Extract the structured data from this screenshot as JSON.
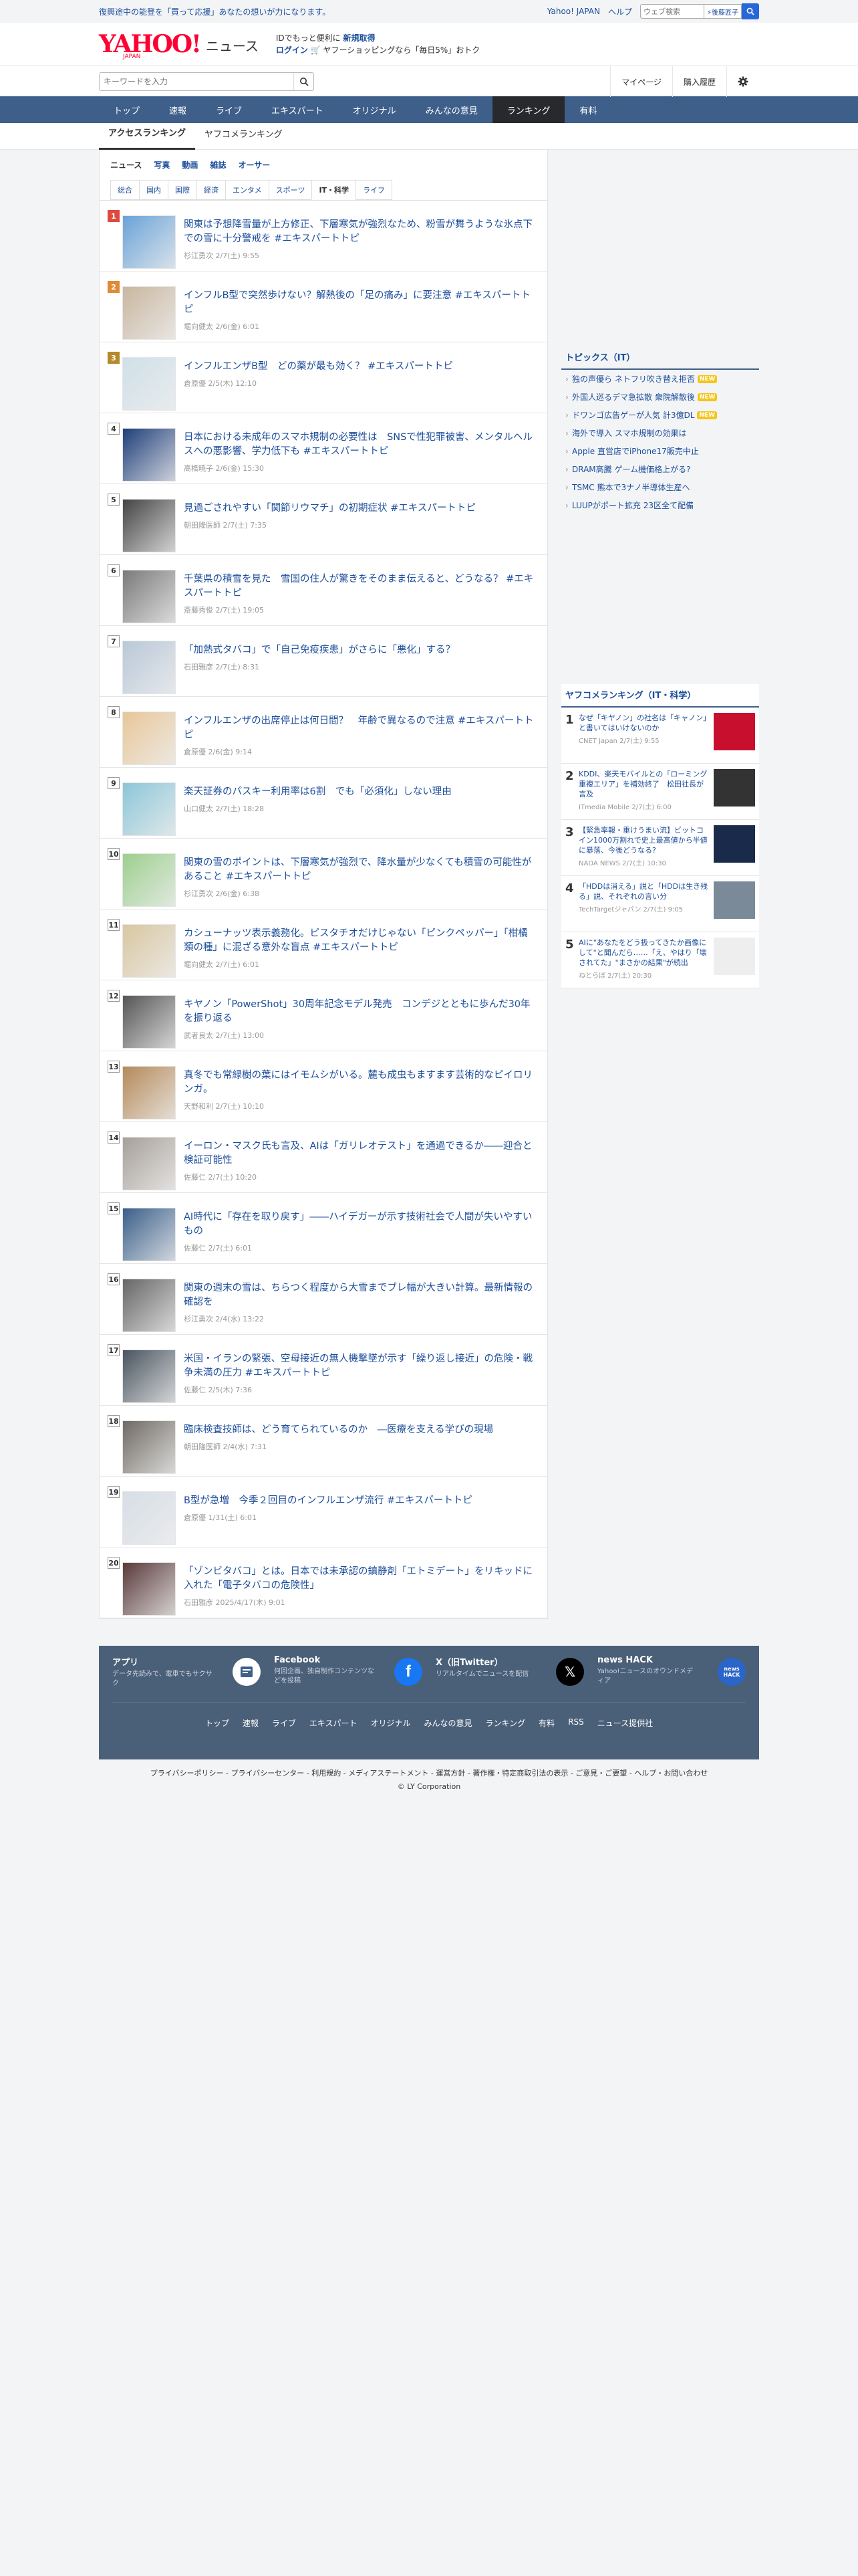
{
  "top": {
    "message": "復興途中の能登を「買って応援」あなたの想いが力になります。",
    "links": [
      "Yahoo! JAPAN",
      "ヘルプ"
    ],
    "search_placeholder": "ウェブ検索",
    "search_chip": "⚡後藤匠子"
  },
  "header": {
    "logo": "YAHOO!",
    "logo_sub": "JAPAN",
    "logo_news": "ニュース",
    "promo_line1a": "IDでもっと便利に",
    "promo_line1b": "新規取得",
    "promo_line2a": "ログイン",
    "promo_line2b": "ヤフーショッピングなら「毎日5%」おトク"
  },
  "searchbar": {
    "placeholder": "キーワードを入力",
    "mypage": "マイページ",
    "history": "購入履歴"
  },
  "gnav": [
    "トップ",
    "速報",
    "ライブ",
    "エキスパート",
    "オリジナル",
    "みんなの意見",
    "ランキング",
    "有料"
  ],
  "gnav_active": "ランキング",
  "subtabs": [
    "アクセスランキング",
    "ヤフコメランキング"
  ],
  "catnav": [
    "ニュース",
    "写真",
    "動画",
    "雑誌",
    "オーサー"
  ],
  "genre_tabs": [
    "総合",
    "国内",
    "国際",
    "経済",
    "エンタメ",
    "スポーツ",
    "IT・科学",
    "ライフ"
  ],
  "genre_active": "IT・科学",
  "ranking": [
    {
      "rank": "1",
      "title": "関東は予想降雪量が上方修正、下層寒気が強烈なため、粉雪が舞うような氷点下での雪に十分警戒を #エキスパートトピ",
      "meta": "杉江勇次  2/7(土) 9:55"
    },
    {
      "rank": "2",
      "title": "インフルB型で突然歩けない？解熱後の「足の痛み」に要注意 #エキスパートトピ",
      "meta": "堀向健太  2/6(金) 6:01"
    },
    {
      "rank": "3",
      "title": "インフルエンザB型　どの薬が最も効く？ #エキスパートトピ",
      "meta": "倉原優  2/5(木) 12:10"
    },
    {
      "rank": "4",
      "title": "日本における未成年のスマホ規制の必要性は　SNSで性犯罪被害、メンタルヘルスへの悪影響、学力低下も #エキスパートトピ",
      "meta": "高橋暁子  2/6(金) 15:30"
    },
    {
      "rank": "5",
      "title": "見過ごされやすい「関節リウマチ」の初期症状 #エキスパートトピ",
      "meta": "朝田隆医師  2/7(土) 7:35"
    },
    {
      "rank": "6",
      "title": "千葉県の積雪を見た　雪国の住人が驚きをそのまま伝えると、どうなる？ #エキスパートトピ",
      "meta": "斎藤秀俊  2/7(土) 19:05"
    },
    {
      "rank": "7",
      "title": "「加熱式タバコ」で「自己免疫疾患」がさらに「悪化」する？",
      "meta": "石田雅彦  2/7(土) 8:31"
    },
    {
      "rank": "8",
      "title": "インフルエンザの出席停止は何日間？　年齢で異なるので注意 #エキスパートトピ",
      "meta": "倉原優  2/6(金) 9:14"
    },
    {
      "rank": "9",
      "title": "楽天証券のパスキー利用率は6割　でも「必須化」しない理由",
      "meta": "山口健太  2/7(土) 18:28"
    },
    {
      "rank": "10",
      "title": "関東の雪のポイントは、下層寒気が強烈で、降水量が少なくても積雪の可能性があること #エキスパートトピ",
      "meta": "杉江勇次  2/6(金) 6:38"
    },
    {
      "rank": "11",
      "title": "カシューナッツ表示義務化。ピスタチオだけじゃない「ピンクペッパー」「柑橘類の種」に混ざる意外な盲点 #エキスパートトピ",
      "meta": "堀向健太  2/7(土) 6:01"
    },
    {
      "rank": "12",
      "title": "キヤノン「PowerShot」30周年記念モデル発売　コンデジとともに歩んだ30年を振り返る",
      "meta": "武者良太  2/7(土) 13:00"
    },
    {
      "rank": "13",
      "title": "真冬でも常緑樹の葉にはイモムシがいる。麓も成虫もますます芸術的なピイロリンガ。",
      "meta": "天野和利  2/7(土) 10:10"
    },
    {
      "rank": "14",
      "title": "イーロン・マスク氏も言及、AIは「ガリレオテスト」を通過できるか――迎合と検証可能性",
      "meta": "佐藤仁  2/7(土) 10:20"
    },
    {
      "rank": "15",
      "title": "AI時代に「存在を取り戻す」――ハイデガーが示す技術社会で人間が失いやすいもの",
      "meta": "佐藤仁  2/7(土) 6:01"
    },
    {
      "rank": "16",
      "title": "関東の週末の雪は、ちらつく程度から大雪までブレ幅が大きい計算。最新情報の確認を",
      "meta": "杉江勇次  2/4(水) 13:22"
    },
    {
      "rank": "17",
      "title": "米国・イランの緊張、空母接近の無人機撃墜が示す「繰り返し接近」の危険・戦争未満の圧力 #エキスパートトピ",
      "meta": "佐藤仁  2/5(木) 7:36"
    },
    {
      "rank": "18",
      "title": "臨床検査技師は、どう育てられているのか　―医療を支える学びの現場",
      "meta": "朝田隆医師  2/4(水) 7:31"
    },
    {
      "rank": "19",
      "title": "B型が急増　今季２回目のインフルエンザ流行 #エキスパートトピ",
      "meta": "倉原優  1/31(土) 6:01"
    },
    {
      "rank": "20",
      "title": "「ゾンビタバコ」とは。日本では未承認の鎮静剤「エトミデート」をリキッドに入れた「電子タバコの危険性」",
      "meta": "石田雅彦  2025/4/17(木) 9:01"
    }
  ],
  "topics": {
    "heading": "トピックス（IT）",
    "items": [
      {
        "text": "独の声優ら ネトフリ吹き替え拒否",
        "new": true
      },
      {
        "text": "外国人巡るデマ急拡散 衆院解散後",
        "new": true
      },
      {
        "text": "ドワンゴ広告ゲーが人気 計3億DL",
        "new": true
      },
      {
        "text": "海外で導入 スマホ規制の効果は",
        "new": false
      },
      {
        "text": "Apple 直営店でiPhone17販売中止",
        "new": false
      },
      {
        "text": "DRAM高騰 ゲーム機価格上がる?",
        "new": false
      },
      {
        "text": "TSMC 熊本で3ナノ半導体生産へ",
        "new": false
      },
      {
        "text": "LUUPがポート拡充 23区全て配備",
        "new": false
      }
    ],
    "new_label": "NEW"
  },
  "yafuko": {
    "heading": "ヤフコメランキング（IT・科学）",
    "items": [
      {
        "rank": "1",
        "title": "なぜ「キヤノン」の社名は「キャノン」と書いてはいけないのか",
        "meta": "CNET Japan 2/7(土) 9:55"
      },
      {
        "rank": "2",
        "title": "KDDI、楽天モバイルとの「ローミング重複エリア」を補効終了　松田社長が言及",
        "meta": "ITmedia Mobile 2/7(土) 6:00"
      },
      {
        "rank": "3",
        "title": "【緊急率報・重けうまい流】ビットコイン1000万割れで史上最高値から半値に暴落、今後どうなる?",
        "meta": "NADA NEWS 2/7(土) 10:30"
      },
      {
        "rank": "4",
        "title": "「HDDは消える」説と「HDDは生き残る」説、それぞれの言い分",
        "meta": "TechTargetジャパン 2/7(土) 9:05"
      },
      {
        "rank": "5",
        "title": "AIに\"あなたをどう扱ってきたか画像にして\"と聞んだら……「え、やはり「壊されてた」\"まさかの結果\"が続出",
        "meta": "ねとらぼ 2/7(土) 20:30"
      }
    ]
  },
  "apps": [
    {
      "title": "アプリ",
      "desc": "データ先読みで、電車でもサクサク"
    },
    {
      "title": "Facebook",
      "desc": "何回企画、独自制作コンテンツなどを投稿"
    },
    {
      "title": "X（旧Twitter）",
      "desc": "リアルタイムでニュースを配信"
    },
    {
      "title": "news HACK",
      "desc": "Yahoo!ニュースのオウンドメディア"
    }
  ],
  "footer_nav": [
    "トップ",
    "速報",
    "ライブ",
    "エキスパート",
    "オリジナル",
    "みんなの意見",
    "ランキング",
    "有料",
    "RSS",
    "ニュース提供社"
  ],
  "footer_links": "プライバシーポリシー - プライバシーセンター - 利用規約 - メディアステートメント - 運営方針 - 著作権・特定商取引法の表示 - ご意見・ご要望 - ヘルプ・お問い合わせ",
  "copyright": "© LY Corporation",
  "colors": {
    "accent": "#3e5f8a",
    "link": "#1d4e9c",
    "brand": "#ff0033"
  }
}
